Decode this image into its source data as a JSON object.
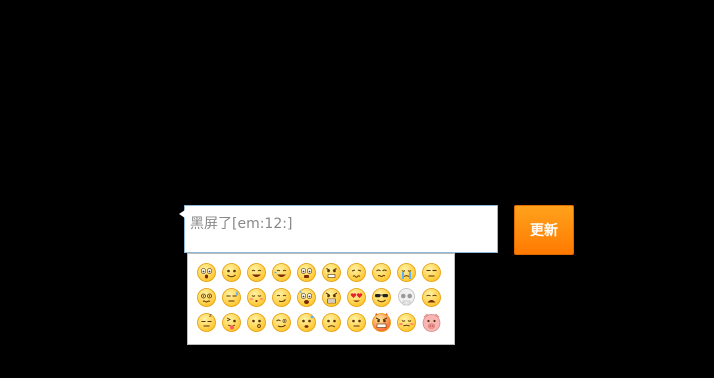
{
  "comment_input": {
    "value": "黑屏了[em:12:]"
  },
  "update_button": {
    "label": "更新"
  },
  "emoji_panel": {
    "colors": {
      "face": "#ffc326",
      "face_edge": "#e59a00",
      "pig": "#f7b5b3",
      "skull": "#f0f0f0"
    },
    "emojis": [
      {
        "icon": "surprised-face-icon"
      },
      {
        "icon": "smile-face-icon"
      },
      {
        "icon": "grin-face-icon"
      },
      {
        "icon": "laughing-face-icon"
      },
      {
        "icon": "shocked-face-icon"
      },
      {
        "icon": "angry-face-icon"
      },
      {
        "icon": "frustrated-face-icon"
      },
      {
        "icon": "confused-face-icon"
      },
      {
        "icon": "crying-face-icon"
      },
      {
        "icon": "unamused-face-icon"
      },
      {
        "icon": "dizzy-face-icon"
      },
      {
        "icon": "sweat-face-icon"
      },
      {
        "icon": "shy-face-icon"
      },
      {
        "icon": "smirk-face-icon"
      },
      {
        "icon": "scared-face-icon"
      },
      {
        "icon": "mad-face-icon"
      },
      {
        "icon": "heart-eyes-face-icon"
      },
      {
        "icon": "sunglasses-face-icon"
      },
      {
        "icon": "skull-icon"
      },
      {
        "icon": "sad-face-icon"
      },
      {
        "icon": "sleepy-face-icon"
      },
      {
        "icon": "tongue-face-icon"
      },
      {
        "icon": "whistle-face-icon"
      },
      {
        "icon": "wink-face-icon"
      },
      {
        "icon": "awkward-face-icon"
      },
      {
        "icon": "frown-face-icon"
      },
      {
        "icon": "neutral-face-icon"
      },
      {
        "icon": "devil-face-icon"
      },
      {
        "icon": "embarrassed-face-icon"
      },
      {
        "icon": "pig-face-icon"
      }
    ]
  }
}
